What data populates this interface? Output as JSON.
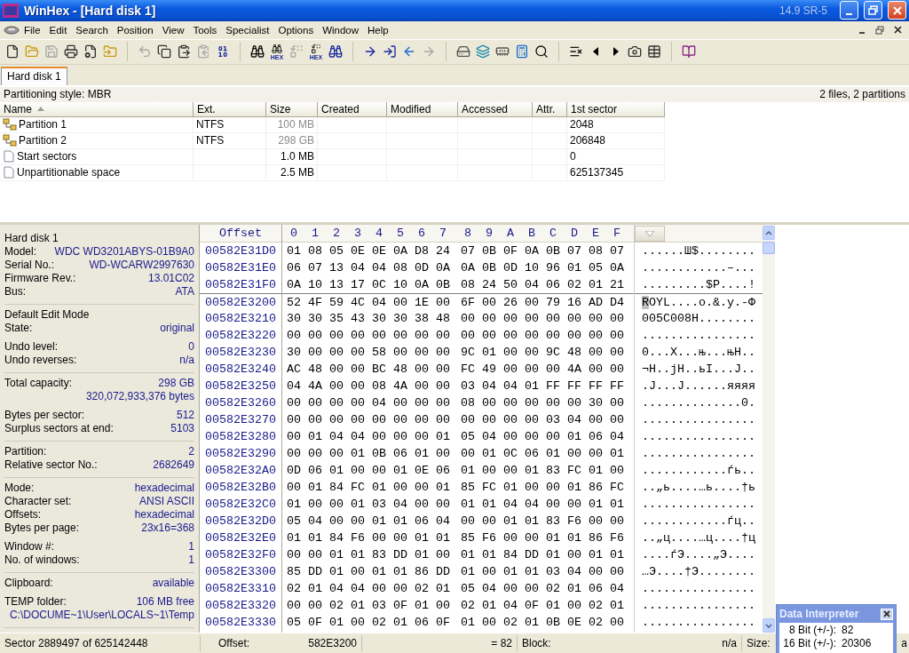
{
  "window": {
    "title": "WinHex - [Hard disk 1]",
    "version": "14.9 SR-5"
  },
  "menu": [
    "File",
    "Edit",
    "Search",
    "Position",
    "View",
    "Tools",
    "Specialist",
    "Options",
    "Window",
    "Help"
  ],
  "toolbar": [
    [
      {
        "kind": "new",
        "disabled": false
      },
      {
        "kind": "open",
        "disabled": false
      },
      {
        "kind": "save",
        "disabled": true
      },
      {
        "kind": "print",
        "disabled": false
      },
      {
        "kind": "properties",
        "disabled": false
      },
      {
        "kind": "export",
        "disabled": false
      }
    ],
    [
      {
        "kind": "undo",
        "disabled": true
      },
      {
        "kind": "copy",
        "disabled": false
      },
      {
        "kind": "paste",
        "disabled": false
      },
      {
        "kind": "clipboard",
        "disabled": true
      },
      {
        "kind": "binary",
        "disabled": false
      }
    ],
    [
      {
        "kind": "find",
        "disabled": false
      },
      {
        "kind": "find",
        "caption": "HEX",
        "disabled": false
      },
      {
        "kind": "replace",
        "disabled": true
      },
      {
        "kind": "replace",
        "caption": "HEX",
        "disabled": false
      },
      {
        "kind": "findagain",
        "disabled": false
      }
    ],
    [
      {
        "kind": "goto",
        "disabled": false
      },
      {
        "kind": "enter",
        "disabled": false
      },
      {
        "kind": "back",
        "disabled": false
      },
      {
        "kind": "forward",
        "disabled": true
      }
    ],
    [
      {
        "kind": "disk",
        "disabled": false
      },
      {
        "kind": "layers",
        "disabled": false
      },
      {
        "kind": "memory",
        "disabled": false
      },
      {
        "kind": "calculator",
        "disabled": false
      },
      {
        "kind": "search",
        "disabled": false
      }
    ],
    [
      {
        "kind": "checklist",
        "disabled": false
      },
      {
        "kind": "prev",
        "disabled": false
      },
      {
        "kind": "next",
        "disabled": false
      },
      {
        "kind": "camera",
        "disabled": false
      },
      {
        "kind": "table",
        "disabled": false
      }
    ],
    [
      {
        "kind": "book",
        "disabled": false
      }
    ]
  ],
  "tabs": [
    {
      "label": "Hard disk 1",
      "selected": true
    }
  ],
  "directory": {
    "partitioning": "Partitioning style: MBR",
    "summary": "2 files, 2 partitions",
    "columns": [
      {
        "label": "Name",
        "sorted": true
      },
      {
        "label": "Ext.",
        "sorted": false
      },
      {
        "label": "Size",
        "sorted": false
      },
      {
        "label": "Created",
        "sorted": false
      },
      {
        "label": "Modified",
        "sorted": false
      },
      {
        "label": "Accessed",
        "sorted": false
      },
      {
        "label": "Attr.",
        "sorted": false
      },
      {
        "label": "1st sector",
        "sorted": false
      }
    ],
    "rows": [
      {
        "kind": "partition",
        "name": "Partition 1",
        "ext": "NTFS",
        "size": "100 MB",
        "first_sector": "2048"
      },
      {
        "kind": "partition",
        "name": "Partition 2",
        "ext": "NTFS",
        "size": "298 GB",
        "first_sector": "206848"
      },
      {
        "kind": "file",
        "name": "Start sectors",
        "size": "1.0 MB",
        "first_sector": "0"
      },
      {
        "kind": "file",
        "name": "Unpartitionable space",
        "size": "2.5 MB",
        "first_sector": "625137345"
      }
    ]
  },
  "info_panel": [
    [
      [
        {
          "label": "Hard disk 1"
        },
        {
          "label": "Model:",
          "value": "WDC WD3201ABYS-01B9A0"
        },
        {
          "label": "Serial No.:",
          "value": "WD-WCARW2997630"
        },
        {
          "label": "Firmware Rev.:",
          "value": "13.01C02"
        },
        {
          "label": "Bus:",
          "value": "ATA"
        }
      ]
    ],
    [
      [
        {
          "label": "Default Edit Mode"
        },
        {
          "label": "State:",
          "value": "original"
        }
      ],
      [
        {
          "label": "Undo level:",
          "value": "0"
        },
        {
          "label": "Undo reverses:",
          "value": "n/a"
        }
      ]
    ],
    [
      [
        {
          "label": "Total capacity:",
          "value": "298 GB"
        },
        {
          "value": "320,072,933,376 bytes"
        }
      ],
      [
        {
          "label": "Bytes per sector:",
          "value": "512"
        },
        {
          "label": "Surplus sectors at end:",
          "value": "5103"
        }
      ]
    ],
    [
      [
        {
          "label": "Partition:",
          "value": "2"
        },
        {
          "label": "Relative sector No.:",
          "value": "2682649"
        }
      ]
    ],
    [
      [
        {
          "label": "Mode:",
          "value": "hexadecimal"
        },
        {
          "label": "Character set:",
          "value": "ANSI ASCII"
        },
        {
          "label": "Offsets:",
          "value": "hexadecimal"
        },
        {
          "label": "Bytes per page:",
          "value": "23x16=368"
        }
      ],
      [
        {
          "label": "Window #:",
          "value": "1"
        },
        {
          "label": "No. of windows:",
          "value": "1"
        }
      ]
    ],
    [
      [
        {
          "label": "Clipboard:",
          "value": "available"
        }
      ],
      [
        {
          "label": "TEMP folder:",
          "value": "106 MB free"
        },
        {
          "value": "C:\\DOCUME~1\\User\\LOCALS~1\\Temp"
        }
      ]
    ]
  ],
  "hex": {
    "offset_label": "Offset",
    "byte_columns": [
      "0",
      "1",
      "2",
      "3",
      "4",
      "5",
      "6",
      "7",
      "8",
      "9",
      "A",
      "B",
      "C",
      "D",
      "E",
      "F"
    ],
    "rows": [
      {
        "offset": "00582E31D0",
        "hex": [
          "01 08 05 0E 0E 0A D8 24",
          "07 0B 0F 0A 0B 07 08 07"
        ],
        "text": "......Ш$........",
        "sector_start": false,
        "cursor": false
      },
      {
        "offset": "00582E31E0",
        "hex": [
          "06 07 13 04 04 08 0D 0A",
          "0A 0B 0D 10 96 01 05 0A"
        ],
        "text": "............–...",
        "sector_start": false,
        "cursor": false
      },
      {
        "offset": "00582E31F0",
        "hex": [
          "0A 10 13 17 0C 10 0A 0B",
          "08 24 50 04 06 02 01 21"
        ],
        "text": ".........$P....!",
        "sector_start": false,
        "cursor": false
      },
      {
        "offset": "00582E3200",
        "hex": [
          "52 4F 59 4C 04 00 1E 00",
          "6F 00 26 00 79 16 AD D4"
        ],
        "text": "ROYL....o.&.y.-Ф",
        "sector_start": true,
        "cursor": true
      },
      {
        "offset": "00582E3210",
        "hex": [
          "30 30 35 43 30 30 38 48",
          "00 00 00 00 00 00 00 00"
        ],
        "text": "005C008H........",
        "sector_start": false,
        "cursor": false
      },
      {
        "offset": "00582E3220",
        "hex": [
          "00 00 00 00 00 00 00 00",
          "00 00 00 00 00 00 00 00"
        ],
        "text": "................",
        "sector_start": false,
        "cursor": false
      },
      {
        "offset": "00582E3230",
        "hex": [
          "30 00 00 00 58 00 00 00",
          "9C 01 00 00 9C 48 00 00"
        ],
        "text": "0...X...њ...њH..",
        "sector_start": false,
        "cursor": false
      },
      {
        "offset": "00582E3240",
        "hex": [
          "AC 48 00 00 BC 48 00 00",
          "FC 49 00 00 00 4A 00 00"
        ],
        "text": "¬H..јH..ьI...J..",
        "sector_start": false,
        "cursor": false
      },
      {
        "offset": "00582E3250",
        "hex": [
          "04 4A 00 00 08 4A 00 00",
          "03 04 04 01 FF FF FF FF"
        ],
        "text": ".J...J......яяяя",
        "sector_start": false,
        "cursor": false
      },
      {
        "offset": "00582E3260",
        "hex": [
          "00 00 00 00 04 00 00 00",
          "08 00 00 00 00 00 30 00"
        ],
        "text": "..............0.",
        "sector_start": false,
        "cursor": false
      },
      {
        "offset": "00582E3270",
        "hex": [
          "00 00 00 00 00 00 00 00",
          "00 00 00 00 03 04 00 00"
        ],
        "text": "................",
        "sector_start": false,
        "cursor": false
      },
      {
        "offset": "00582E3280",
        "hex": [
          "00 01 04 04 00 00 00 01",
          "05 04 00 00 00 01 06 04"
        ],
        "text": "................",
        "sector_start": false,
        "cursor": false
      },
      {
        "offset": "00582E3290",
        "hex": [
          "00 00 00 01 0B 06 01 00",
          "00 01 0C 06 01 00 00 01"
        ],
        "text": "................",
        "sector_start": false,
        "cursor": false
      },
      {
        "offset": "00582E32A0",
        "hex": [
          "0D 06 01 00 00 01 0E 06",
          "01 00 00 01 83 FC 01 00"
        ],
        "text": "............ѓь..",
        "sector_start": false,
        "cursor": false
      },
      {
        "offset": "00582E32B0",
        "hex": [
          "00 01 84 FC 01 00 00 01",
          "85 FC 01 00 00 01 86 FC"
        ],
        "text": "..„ь....…ь....†ь",
        "sector_start": false,
        "cursor": false
      },
      {
        "offset": "00582E32C0",
        "hex": [
          "01 00 00 01 03 04 00 00",
          "01 01 04 04 00 00 01 01"
        ],
        "text": "................",
        "sector_start": false,
        "cursor": false
      },
      {
        "offset": "00582E32D0",
        "hex": [
          "05 04 00 00 01 01 06 04",
          "00 00 01 01 83 F6 00 00"
        ],
        "text": "............ѓц..",
        "sector_start": false,
        "cursor": false
      },
      {
        "offset": "00582E32E0",
        "hex": [
          "01 01 84 F6 00 00 01 01",
          "85 F6 00 00 01 01 86 F6"
        ],
        "text": "..„ц....…ц....†ц",
        "sector_start": false,
        "cursor": false
      },
      {
        "offset": "00582E32F0",
        "hex": [
          "00 00 01 01 83 DD 01 00",
          "01 01 84 DD 01 00 01 01"
        ],
        "text": "....ѓЭ....„Э....",
        "sector_start": false,
        "cursor": false
      },
      {
        "offset": "00582E3300",
        "hex": [
          "85 DD 01 00 01 01 86 DD",
          "01 00 01 01 03 04 00 00"
        ],
        "text": "…Э....†Э........",
        "sector_start": false,
        "cursor": false
      },
      {
        "offset": "00582E3310",
        "hex": [
          "02 01 04 04 00 00 02 01",
          "05 04 00 00 02 01 06 04"
        ],
        "text": "................",
        "sector_start": false,
        "cursor": false
      },
      {
        "offset": "00582E3320",
        "hex": [
          "00 00 02 01 03 0F 01 00",
          "02 01 04 0F 01 00 02 01"
        ],
        "text": "................",
        "sector_start": false,
        "cursor": false
      },
      {
        "offset": "00582E3330",
        "hex": [
          "05 0F 01 00 02 01 06 0F",
          "01 00 02 01 0B 0E 02 00"
        ],
        "text": "................",
        "sector_start": false,
        "cursor": false
      }
    ]
  },
  "status": {
    "sector": "Sector 2889497 of 625142448",
    "offset_label": "Offset:",
    "offset": "582E3200",
    "value": "= 82",
    "block_label": "Block:",
    "block": "n/a",
    "size_label": "Size:",
    "size_tail": "a"
  },
  "interpreter": {
    "title": "Data Interpreter",
    "rows": [
      {
        "label": "8 Bit (+/-):",
        "value": "82"
      },
      {
        "label": "16 Bit (+/-):",
        "value": "20306"
      }
    ]
  }
}
